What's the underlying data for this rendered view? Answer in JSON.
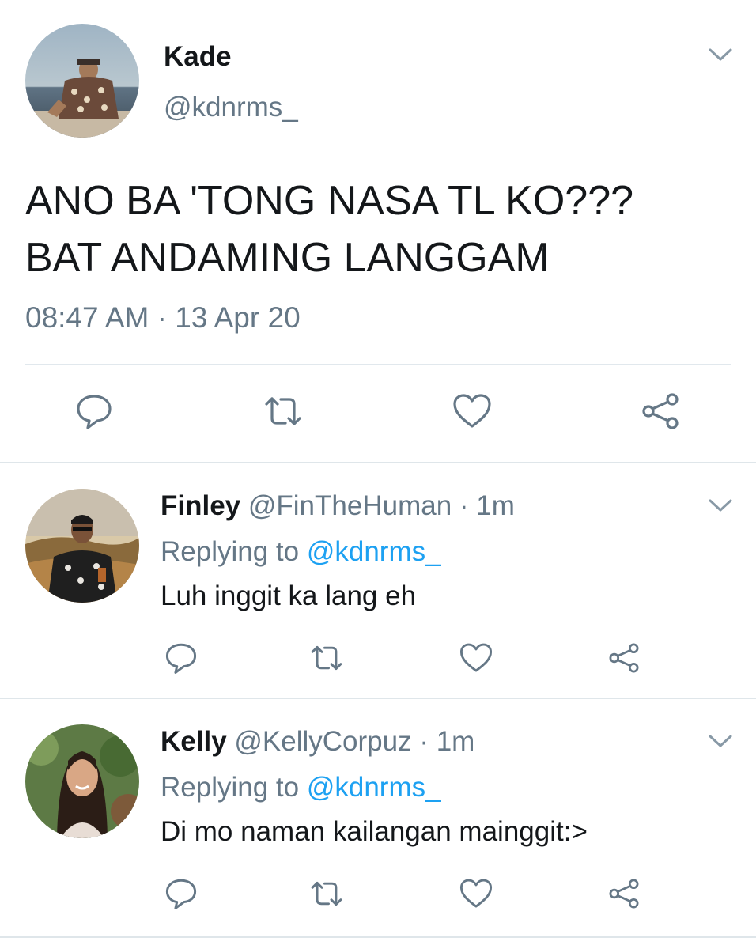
{
  "main_tweet": {
    "name": "Kade",
    "handle": "@kdnrms_",
    "text_line1": "ANO BA 'TONG NASA TL KO???",
    "text_line2": "BAT ANDAMING LANGGAM",
    "time": "08:47 AM",
    "separator": " · ",
    "date": "13 Apr 20",
    "actions": [
      "reply-icon",
      "retweet-icon",
      "like-icon",
      "share-icon"
    ]
  },
  "replies": [
    {
      "name": "Finley",
      "handle": "@FinTheHuman",
      "time_sep": " · ",
      "time": "1m",
      "replying_label": "Replying to ",
      "replying_to": "@kdnrms_",
      "text": "Luh inggit ka lang eh"
    },
    {
      "name": "Kelly",
      "handle": "@KellyCorpuz",
      "time_sep": " · ",
      "time": "1m",
      "replying_label": "Replying to ",
      "replying_to": "@kdnrms_",
      "text": "Di mo naman kailangan mainggit:>"
    }
  ],
  "colors": {
    "text": "#14171a",
    "secondary": "#657786",
    "link": "#1da1f2",
    "divider": "#e1e8ed"
  }
}
